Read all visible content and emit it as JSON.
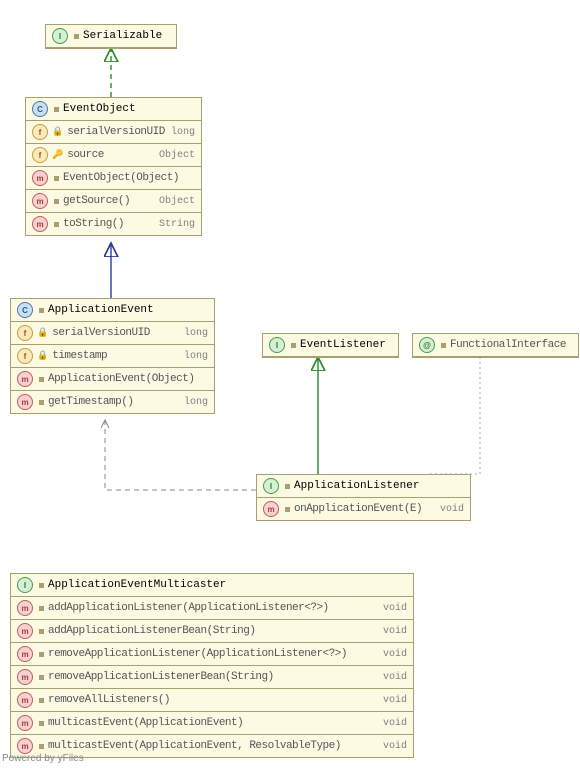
{
  "serializable": {
    "title": "Serializable"
  },
  "eventObject": {
    "title": "EventObject",
    "f1_name": "serialVersionUID",
    "f1_type": "long",
    "f2_name": "source",
    "f2_type": "Object",
    "m1_name": "EventObject(Object)",
    "m2_name": "getSource()",
    "m2_type": "Object",
    "m3_name": "toString()",
    "m3_type": "String"
  },
  "applicationEvent": {
    "title": "ApplicationEvent",
    "f1_name": "serialVersionUID",
    "f1_type": "long",
    "f2_name": "timestamp",
    "f2_type": "long",
    "m1_name": "ApplicationEvent(Object)",
    "m2_name": "getTimestamp()",
    "m2_type": "long"
  },
  "eventListener": {
    "title": "EventListener"
  },
  "functionalInterface": {
    "title": "FunctionalInterface"
  },
  "applicationListener": {
    "title": "ApplicationListener",
    "m1_name": "onApplicationEvent(E)",
    "m1_type": "void"
  },
  "multicaster": {
    "title": "ApplicationEventMulticaster",
    "m1_name": "addApplicationListener(ApplicationListener<?>)",
    "m1_type": "void",
    "m2_name": "addApplicationListenerBean(String)",
    "m2_type": "void",
    "m3_name": "removeApplicationListener(ApplicationListener<?>)",
    "m3_type": "void",
    "m4_name": "removeApplicationListenerBean(String)",
    "m4_type": "void",
    "m5_name": "removeAllListeners()",
    "m5_type": "void",
    "m6_name": "multicastEvent(ApplicationEvent)",
    "m6_type": "void",
    "m7_name": "multicastEvent(ApplicationEvent, ResolvableType)",
    "m7_type": "void"
  },
  "footer": "Powered by yFiles"
}
